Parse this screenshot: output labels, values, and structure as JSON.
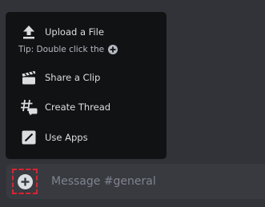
{
  "menu": {
    "items": [
      {
        "label": "Upload a File",
        "icon": "upload-icon"
      },
      {
        "label": "Share a Clip",
        "icon": "clapperboard-icon"
      },
      {
        "label": "Create Thread",
        "icon": "thread-icon"
      },
      {
        "label": "Use Apps",
        "icon": "apps-icon"
      }
    ],
    "tip": "Tip: Double click the"
  },
  "composer": {
    "placeholder": "Message #general",
    "add_icon": "plus-circle-icon"
  },
  "colors": {
    "background": "#313338",
    "menu_background": "#111214",
    "composer_background": "#383a40",
    "text": "#dbdee1",
    "muted_text": "#b5bac1",
    "placeholder": "#80848e",
    "highlight": "#e3202e"
  }
}
